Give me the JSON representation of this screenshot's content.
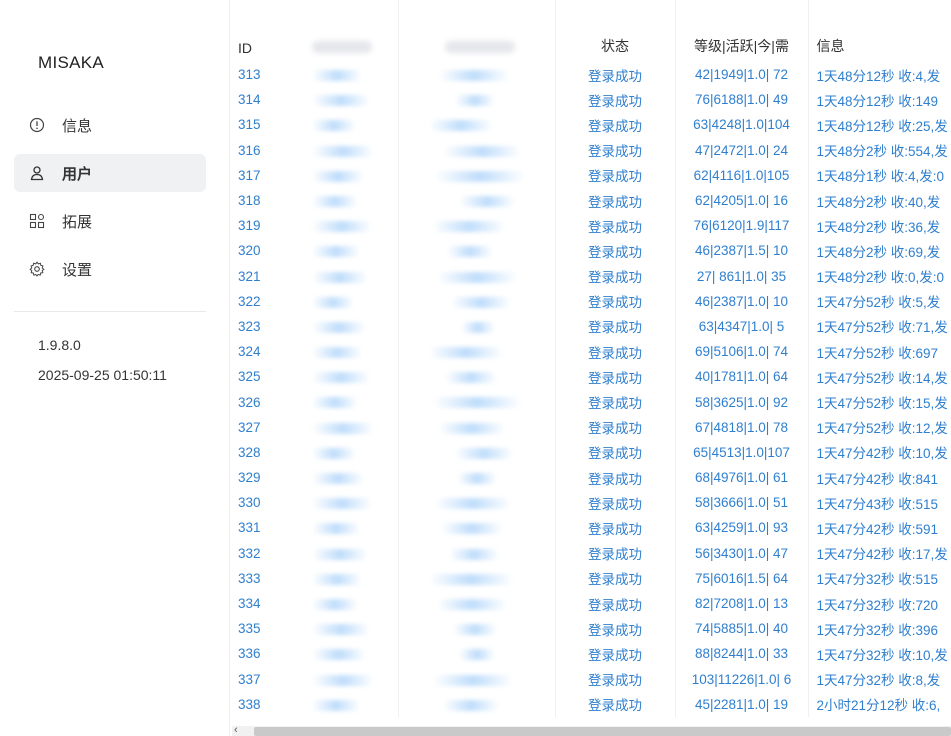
{
  "sidebar": {
    "title": "MISAKA",
    "items": [
      {
        "label": "信息",
        "icon": "info-circle-icon"
      },
      {
        "label": "用户",
        "icon": "user-icon",
        "active": true
      },
      {
        "label": "拓展",
        "icon": "grid-icon"
      },
      {
        "label": "设置",
        "icon": "gear-icon"
      }
    ],
    "version": "1.9.8.0",
    "datetime": "2025-09-25 01:50:11"
  },
  "table": {
    "headers": {
      "id": "ID",
      "status": "状态",
      "level": "等级|活跃|今|需",
      "info": "信息"
    },
    "rows": [
      {
        "id": "313",
        "status": "登录成功",
        "level": "42|1949|1.0| 72",
        "info": "1天48分12秒 收:4,发"
      },
      {
        "id": "314",
        "status": "登录成功",
        "level": "76|6188|1.0| 49",
        "info": "1天48分12秒 收:149"
      },
      {
        "id": "315",
        "status": "登录成功",
        "level": "63|4248|1.0|104",
        "info": "1天48分12秒 收:25,发"
      },
      {
        "id": "316",
        "status": "登录成功",
        "level": "47|2472|1.0| 24",
        "info": "1天48分2秒 收:554,发"
      },
      {
        "id": "317",
        "status": "登录成功",
        "level": "62|4116|1.0|105",
        "info": "1天48分1秒 收:4,发:0"
      },
      {
        "id": "318",
        "status": "登录成功",
        "level": "62|4205|1.0| 16",
        "info": "1天48分2秒 收:40,发"
      },
      {
        "id": "319",
        "status": "登录成功",
        "level": "76|6120|1.9|117",
        "info": "1天48分2秒 收:36,发"
      },
      {
        "id": "320",
        "status": "登录成功",
        "level": "46|2387|1.5| 10",
        "info": "1天48分2秒 收:69,发"
      },
      {
        "id": "321",
        "status": "登录成功",
        "level": "27| 861|1.0| 35",
        "info": "1天48分2秒 收:0,发:0"
      },
      {
        "id": "322",
        "status": "登录成功",
        "level": "46|2387|1.0| 10",
        "info": "1天47分52秒 收:5,发"
      },
      {
        "id": "323",
        "status": "登录成功",
        "level": "63|4347|1.0| 5",
        "info": "1天47分52秒 收:71,发"
      },
      {
        "id": "324",
        "status": "登录成功",
        "level": "69|5106|1.0| 74",
        "info": "1天47分52秒 收:697"
      },
      {
        "id": "325",
        "status": "登录成功",
        "level": "40|1781|1.0| 64",
        "info": "1天47分52秒 收:14,发"
      },
      {
        "id": "326",
        "status": "登录成功",
        "level": "58|3625|1.0| 92",
        "info": "1天47分52秒 收:15,发"
      },
      {
        "id": "327",
        "status": "登录成功",
        "level": "67|4818|1.0| 78",
        "info": "1天47分52秒 收:12,发"
      },
      {
        "id": "328",
        "status": "登录成功",
        "level": "65|4513|1.0|107",
        "info": "1天47分42秒 收:10,发"
      },
      {
        "id": "329",
        "status": "登录成功",
        "level": "68|4976|1.0| 61",
        "info": "1天47分42秒 收:841"
      },
      {
        "id": "330",
        "status": "登录成功",
        "level": "58|3666|1.0| 51",
        "info": "1天47分43秒 收:515"
      },
      {
        "id": "331",
        "status": "登录成功",
        "level": "63|4259|1.0| 93",
        "info": "1天47分42秒 收:591"
      },
      {
        "id": "332",
        "status": "登录成功",
        "level": "56|3430|1.0| 47",
        "info": "1天47分42秒 收:17,发"
      },
      {
        "id": "333",
        "status": "登录成功",
        "level": "75|6016|1.5| 64",
        "info": "1天47分32秒 收:515"
      },
      {
        "id": "334",
        "status": "登录成功",
        "level": "82|7208|1.0| 13",
        "info": "1天47分32秒 收:720"
      },
      {
        "id": "335",
        "status": "登录成功",
        "level": "74|5885|1.0| 40",
        "info": "1天47分32秒 收:396"
      },
      {
        "id": "336",
        "status": "登录成功",
        "level": "88|8244|1.0| 33",
        "info": "1天47分32秒 收:10,发"
      },
      {
        "id": "337",
        "status": "登录成功",
        "level": "103|11226|1.0| 6",
        "info": "1天47分32秒 收:8,发"
      },
      {
        "id": "338",
        "status": "登录成功",
        "level": "45|2281|1.0| 19",
        "info": "2小时21分12秒 收:6,"
      }
    ]
  },
  "scrollbar": {
    "left_arrow": "‹"
  },
  "colors": {
    "link": "#2f7fcf",
    "active_bg": "#f0f1f3"
  }
}
